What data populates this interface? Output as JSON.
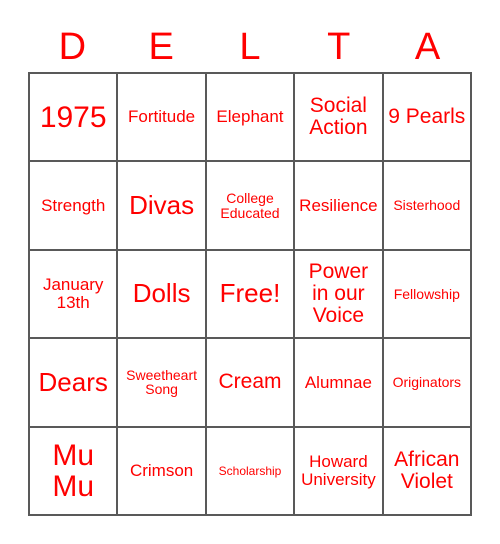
{
  "card": {
    "title_letters": [
      "D",
      "E",
      "L",
      "T",
      "A"
    ],
    "accent_color": "#ff0000",
    "grid_line_color": "#595959",
    "background_color": "#ffffff",
    "rows": 5,
    "columns": 5,
    "cells": [
      [
        {
          "text": "1975",
          "size": "xl"
        },
        {
          "text": "Fortitude",
          "size": "sm"
        },
        {
          "text": "Elephant",
          "size": "sm"
        },
        {
          "text": "Social Action",
          "size": "md"
        },
        {
          "text": "9 Pearls",
          "size": "md"
        }
      ],
      [
        {
          "text": "Strength",
          "size": "sm"
        },
        {
          "text": "Divas",
          "size": "lg"
        },
        {
          "text": "College Educated",
          "size": "xs"
        },
        {
          "text": "Resilience",
          "size": "sm"
        },
        {
          "text": "Sisterhood",
          "size": "xs"
        }
      ],
      [
        {
          "text": "January 13th",
          "size": "sm"
        },
        {
          "text": "Dolls",
          "size": "lg"
        },
        {
          "text": "Free!",
          "size": "lg"
        },
        {
          "text": "Power in our Voice",
          "size": "md"
        },
        {
          "text": "Fellowship",
          "size": "xs"
        }
      ],
      [
        {
          "text": "Dears",
          "size": "lg"
        },
        {
          "text": "Sweetheart Song",
          "size": "xs"
        },
        {
          "text": "Cream",
          "size": "md"
        },
        {
          "text": "Alumnae",
          "size": "sm"
        },
        {
          "text": "Originators",
          "size": "xs"
        }
      ],
      [
        {
          "text": "Mu Mu",
          "size": "xl"
        },
        {
          "text": "Crimson",
          "size": "sm"
        },
        {
          "text": "Scholarship",
          "size": "xxs"
        },
        {
          "text": "Howard University",
          "size": "sm"
        },
        {
          "text": "African Violet",
          "size": "md"
        }
      ]
    ]
  }
}
